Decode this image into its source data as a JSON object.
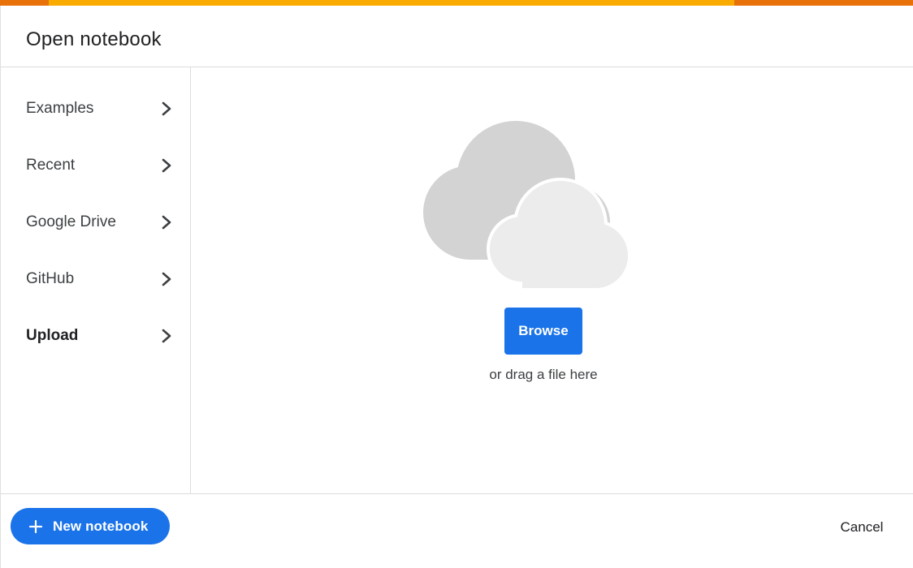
{
  "dialog": {
    "title": "Open notebook"
  },
  "sidebar": {
    "items": [
      {
        "label": "Examples",
        "active": false
      },
      {
        "label": "Recent",
        "active": false
      },
      {
        "label": "Google Drive",
        "active": false
      },
      {
        "label": "GitHub",
        "active": false
      },
      {
        "label": "Upload",
        "active": true
      }
    ]
  },
  "upload": {
    "icon": "cloud-icon",
    "browse_label": "Browse",
    "drag_text": "or drag a file here"
  },
  "footer": {
    "new_notebook_label": "New notebook",
    "new_notebook_icon": "plus-icon",
    "cancel_label": "Cancel"
  },
  "colors": {
    "accent": "#1a73e8",
    "top_bar": "#f9ab00",
    "top_bar_accent": "#e8710a",
    "cloud_dark": "#d3d3d3",
    "cloud_light": "#ececec"
  }
}
